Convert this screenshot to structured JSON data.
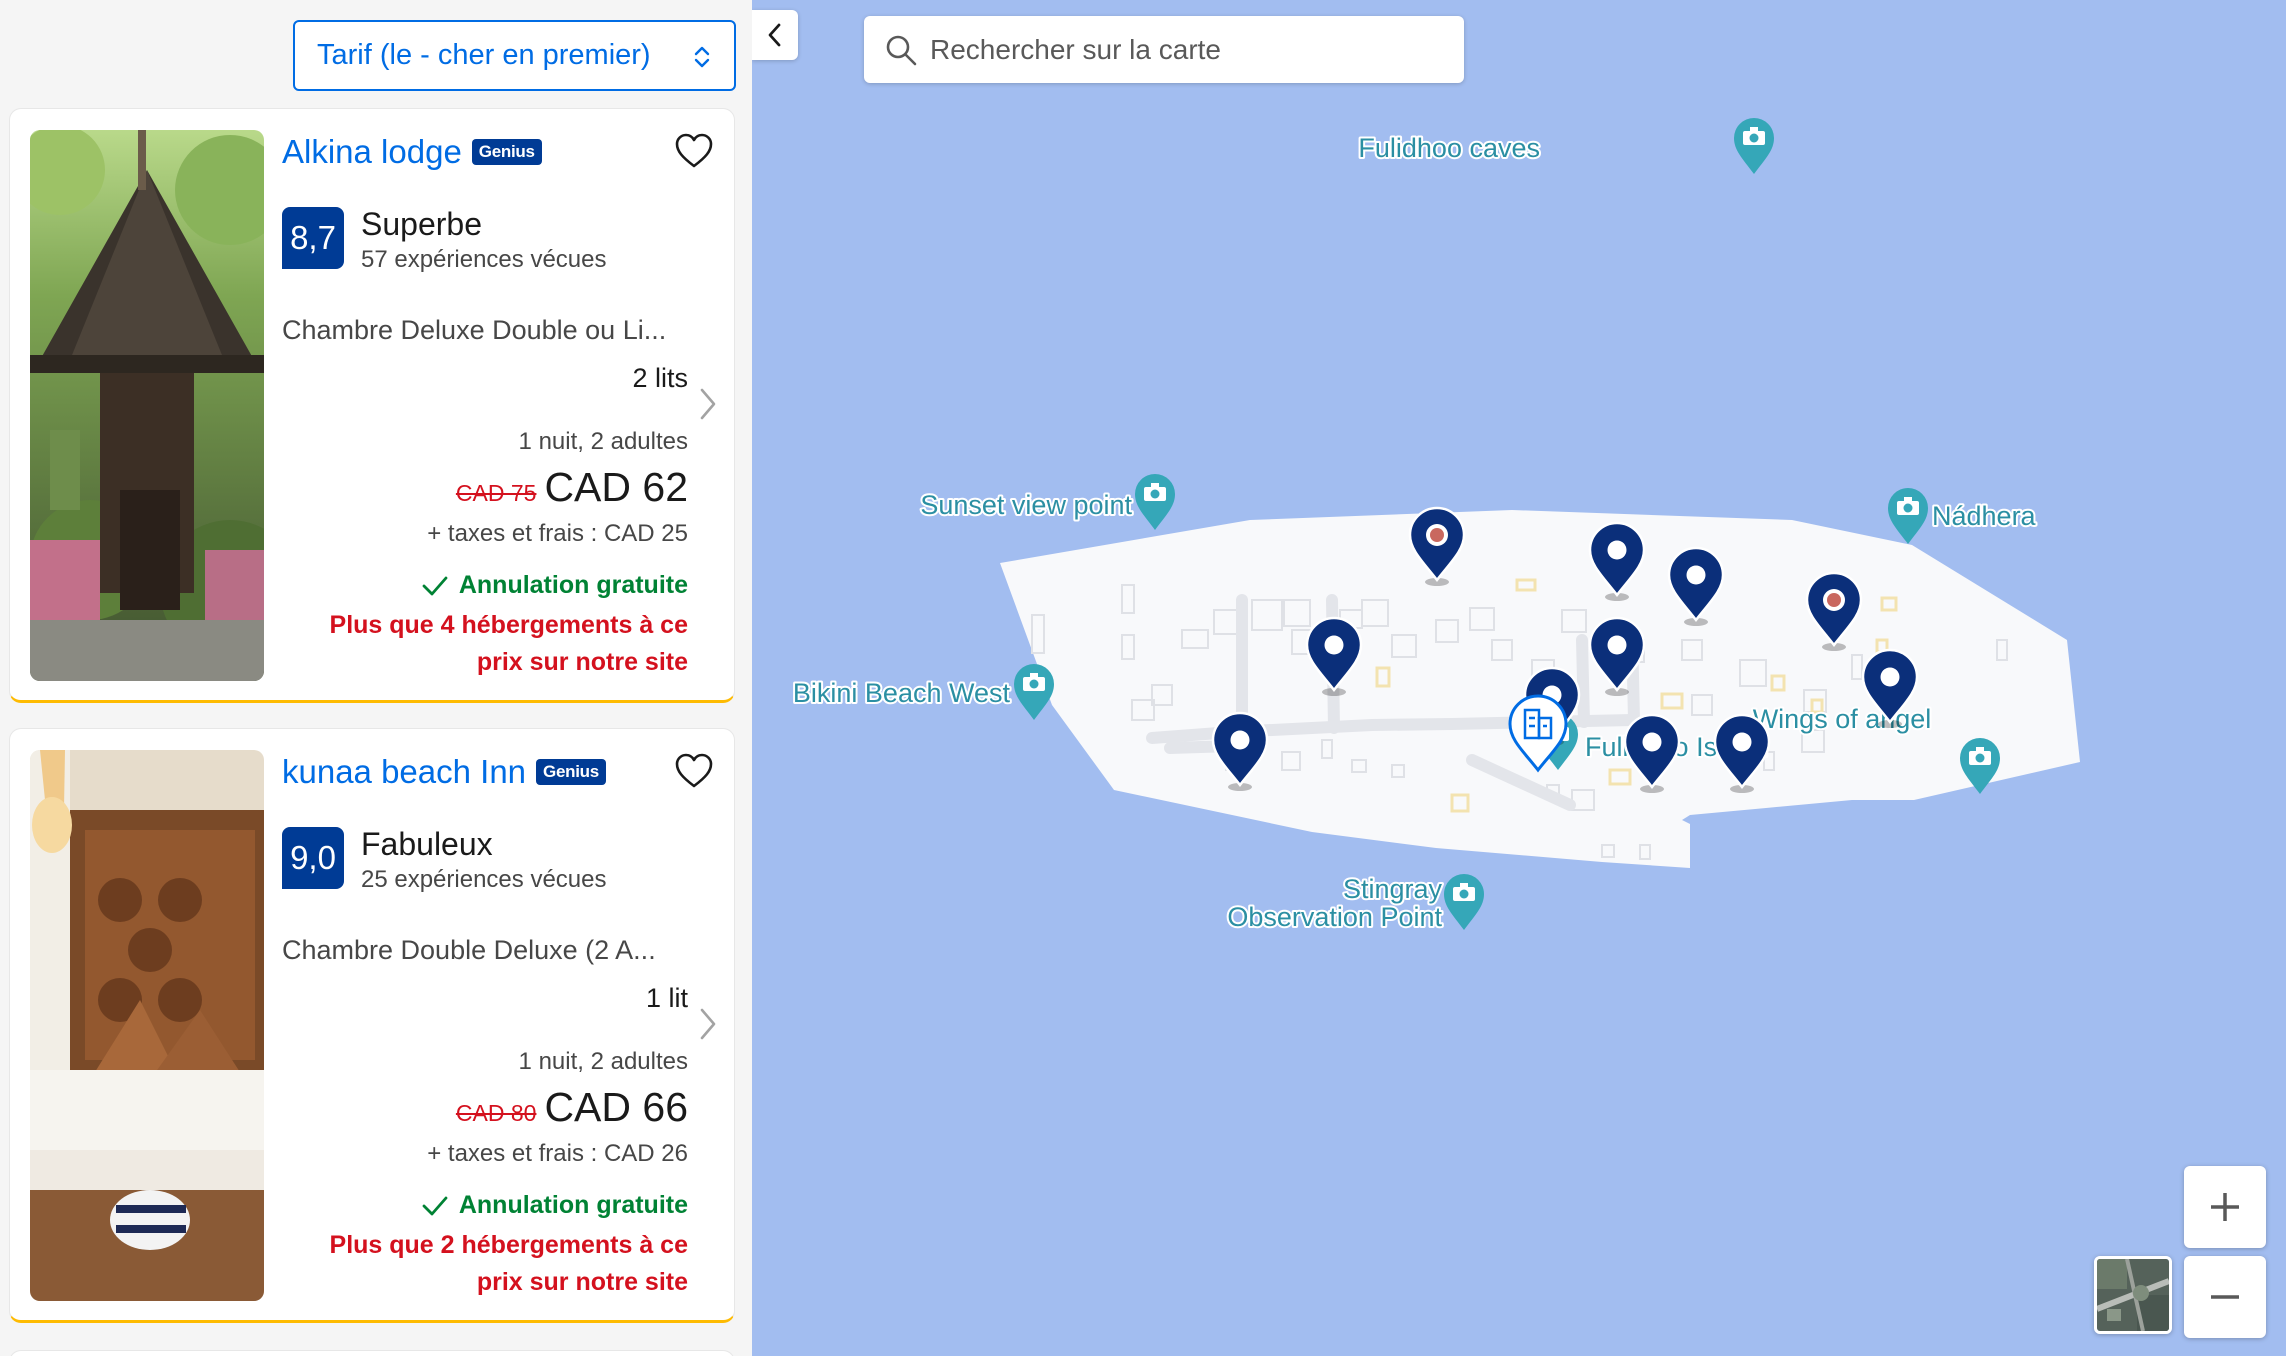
{
  "sort": {
    "label": "Tarif (le - cher en premier)",
    "icon": "sort-arrows-icon"
  },
  "listings": [
    {
      "name": "Alkina lodge",
      "badge": "Genius",
      "score": "8,7",
      "score_word": "Superbe",
      "reviews": "57 expériences vécues",
      "room": "Chambre Deluxe Double ou Li...",
      "beds": "2 lits",
      "stay": "1 nuit, 2 adultes",
      "old_price": "CAD 75",
      "price": "CAD 62",
      "taxes": "+ taxes et frais : CAD 25",
      "cancellation": "Annulation gratuite",
      "availability": "Plus que 4 hébergements à ce prix sur notre site"
    },
    {
      "name": "kunaa beach Inn",
      "badge": "Genius",
      "score": "9,0",
      "score_word": "Fabuleux",
      "reviews": "25 expériences vécues",
      "room": "Chambre Double Deluxe (2 A...",
      "beds": "1 lit",
      "stay": "1 nuit, 2 adultes",
      "old_price": "CAD 80",
      "price": "CAD 66",
      "taxes": "+ taxes et frais : CAD 26",
      "cancellation": "Annulation gratuite",
      "availability": "Plus que 2 hébergements à ce prix sur notre site"
    }
  ],
  "map": {
    "search_placeholder": "Rechercher sur la carte",
    "labels": {
      "fulidhoo_caves": "Fulidhoo caves",
      "sunset_view_point": "Sunset view point",
      "nadhera": "Nádhera",
      "bikini_beach_west": "Bikini Beach West",
      "wings_of_angel": "Wings of angel",
      "fulidhoo_island": "Fulidhoo Island",
      "stingray_1": "Stingray",
      "stingray_2": "Observation Point"
    },
    "zoom_in": "+",
    "zoom_out": "−",
    "colors": {
      "water": "#a2bdf0",
      "land": "#f8f9fb",
      "pin": "#0b2f7a",
      "poi": "#35a7b8",
      "label": "#2b8fa3"
    }
  }
}
